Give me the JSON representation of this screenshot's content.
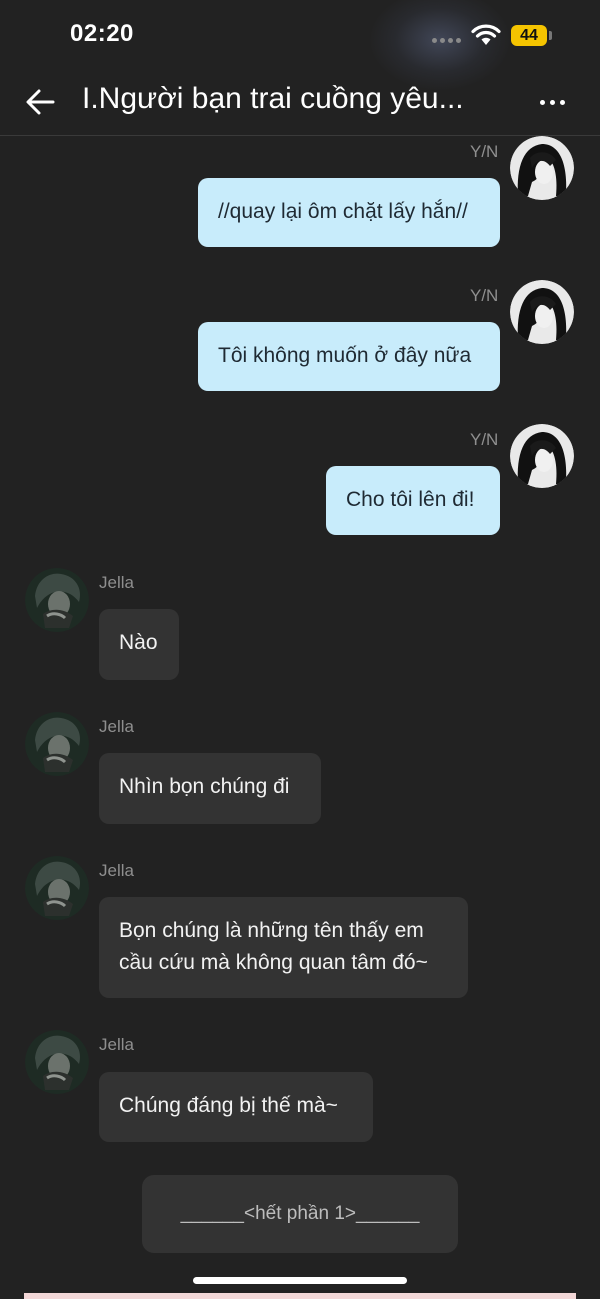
{
  "status_bar": {
    "time": "02:20",
    "battery": "44"
  },
  "header": {
    "title": "I.Người bạn trai cuồng yêu..."
  },
  "messages": [
    {
      "sender": "Y/N",
      "text": "//quay lại ôm chặt lấy hắn//"
    },
    {
      "sender": "Y/N",
      "text": "Tôi không muốn ở đây nữa"
    },
    {
      "sender": "Y/N",
      "text": "Cho tôi lên đi!"
    },
    {
      "sender": "Jella",
      "text": "Nào"
    },
    {
      "sender": "Jella",
      "text": "Nhìn bọn chúng đi"
    },
    {
      "sender": "Jella",
      "text": "Bọn chúng là những tên thấy em cầu cứu mà không quan tâm đó~"
    },
    {
      "sender": "Jella",
      "text": "Chúng đáng bị thế mà~"
    }
  ],
  "end_note": "______<hết phần 1>______",
  "colors": {
    "my_bubble": "#c8ecfb",
    "their_bubble": "#333333",
    "background": "#222222",
    "battery": "#f5c400"
  },
  "icons": {
    "back": "arrow-left-icon",
    "more": "more-dots-icon",
    "wifi": "wifi-icon"
  }
}
